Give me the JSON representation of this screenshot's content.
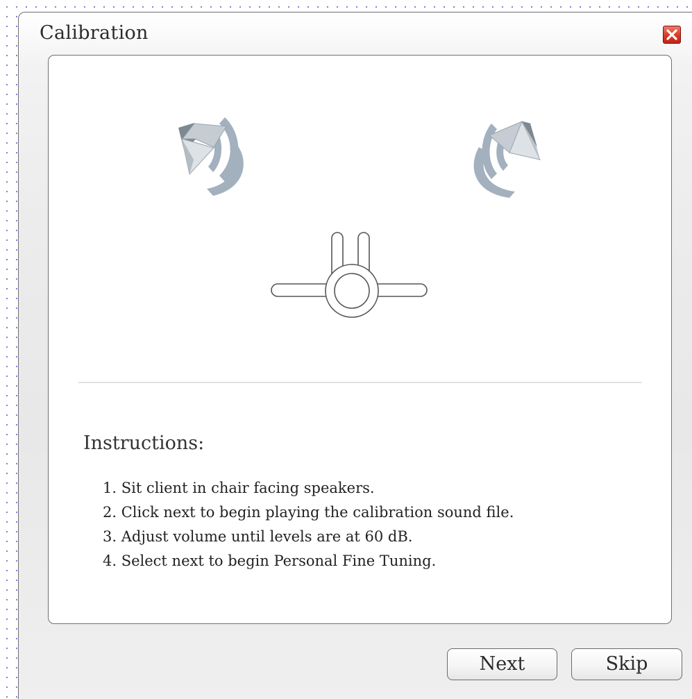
{
  "dialog": {
    "title": "Calibration",
    "close_icon": "close-icon"
  },
  "illustration": {
    "left_speaker_icon": "speaker-icon",
    "right_speaker_icon": "speaker-icon",
    "listener_icon": "chair-listener-icon",
    "speaker_color": "#a3b0be",
    "outline_color": "#555555"
  },
  "instructions": {
    "heading": "Instructions:",
    "steps": [
      "1. Sit client in chair facing speakers.",
      "2. Click next to begin playing the calibration sound file.",
      "3. Adjust volume until levels are at 60 dB.",
      "4. Select next to begin Personal Fine Tuning."
    ]
  },
  "buttons": {
    "next_label": "Next",
    "skip_label": "Skip"
  },
  "colors": {
    "close_button": "#d93a26",
    "panel_background": "#ffffff",
    "dialog_background": "#ececec"
  }
}
